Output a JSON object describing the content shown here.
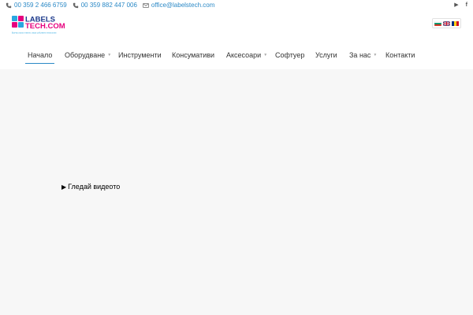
{
  "topbar": {
    "phone_1": "00 359 2 466 6759",
    "phone_2": "00 359 882 447 006",
    "email": "office@labelstech.com",
    "icons": [
      "phone-icon",
      "mobile-icon",
      "envelope-icon"
    ],
    "social": [
      "vimeo-icon",
      "facebook-icon"
    ]
  },
  "logo": {
    "line1": "LABELS",
    "line2": "TECH.COM",
    "tagline": "Всичко около етикети, наши собствени технологии",
    "colors": {
      "blue": "#2aa7e0",
      "magenta": "#e6007e",
      "navy": "#1d3a8c"
    }
  },
  "languages": [
    {
      "code": "bg",
      "name": "Български"
    },
    {
      "code": "en",
      "name": "English"
    },
    {
      "code": "ro",
      "name": "Română"
    }
  ],
  "nav": {
    "items": [
      {
        "label": "Начало",
        "active": true,
        "dropdown": false
      },
      {
        "label": "Оборудване",
        "active": false,
        "dropdown": true
      },
      {
        "label": "Инструменти",
        "active": false,
        "dropdown": false
      },
      {
        "label": "Консумативи",
        "active": false,
        "dropdown": false
      },
      {
        "label": "Аксесоари",
        "active": false,
        "dropdown": true
      },
      {
        "label": "Софтуер",
        "active": false,
        "dropdown": false
      },
      {
        "label": "Услуги",
        "active": false,
        "dropdown": false
      },
      {
        "label": "За нас",
        "active": false,
        "dropdown": true
      },
      {
        "label": "Контакти",
        "active": false,
        "dropdown": false
      }
    ],
    "accent": "#2b89c6"
  },
  "hero": {
    "watch_video_label": "Гледай видеото",
    "play_icon": "▶",
    "background": "#f7f7f7"
  }
}
